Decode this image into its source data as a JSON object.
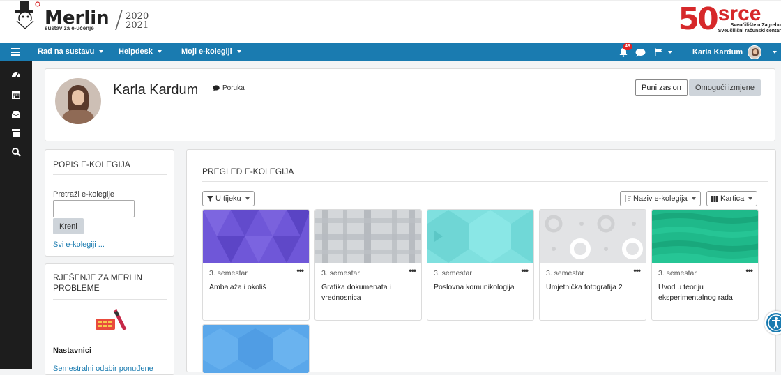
{
  "branding": {
    "name": "Merlin",
    "subtitle": "sustav za e-učenje",
    "year_top": "2020",
    "year_bottom": "2021",
    "srce_50": "50",
    "srce_word": "srce",
    "srce_line1": "Sveučilište u Zagrebu",
    "srce_line2": "Sveučilišni računski centar"
  },
  "navbar": {
    "menu_icon": "hamburger-icon",
    "items": [
      "Rad na sustavu",
      "Helpdesk",
      "Moji e-kolegiji"
    ],
    "notification_count": "48",
    "user_name": "Karla Kardum",
    "color": "#1a7bb0"
  },
  "rail": {
    "icons": [
      "dashboard-icon",
      "calendar-icon",
      "inbox-icon",
      "archive-icon",
      "search-icon"
    ]
  },
  "profile": {
    "name": "Karla Kardum",
    "message_label": "Poruka",
    "fullscreen_label": "Puni zaslon",
    "edit_label": "Omogući izmjene"
  },
  "course_list_block": {
    "title": "POPIS E-KOLEGIJA",
    "search_label": "Pretraži e-kolegije",
    "search_value": "",
    "go_label": "Kreni",
    "all_link": "Svi e-kolegiji ..."
  },
  "help_block": {
    "title": "RJEŠENJE ZA MERLIN PROBLEME",
    "teachers_label": "Nastavnici",
    "link_partial": "Semestralni odabir ponuđene"
  },
  "overview": {
    "title": "PREGLED E-KOLEGIJA",
    "filter_label": "U tijeku",
    "sort_label": "Naziv e-kolegija",
    "view_label": "Kartica",
    "courses": [
      {
        "semester": "3. semestar",
        "name": "Ambalaža i okoliš",
        "color": "#6f57d8"
      },
      {
        "semester": "3. semestar",
        "name": "Grafika dokumenata i vrednosnica",
        "color": "#c9cdd1"
      },
      {
        "semester": "3. semestar",
        "name": "Poslovna komunikologija",
        "color": "#7fe0df"
      },
      {
        "semester": "3. semestar",
        "name": "Umjetnička fotografija 2",
        "color": "#d8d9db"
      },
      {
        "semester": "3. semestar",
        "name": "Uvod u teoriju eksperimentalnog rada",
        "color": "#1fb98a"
      }
    ],
    "extra_course_color": "#5aa7ea"
  }
}
